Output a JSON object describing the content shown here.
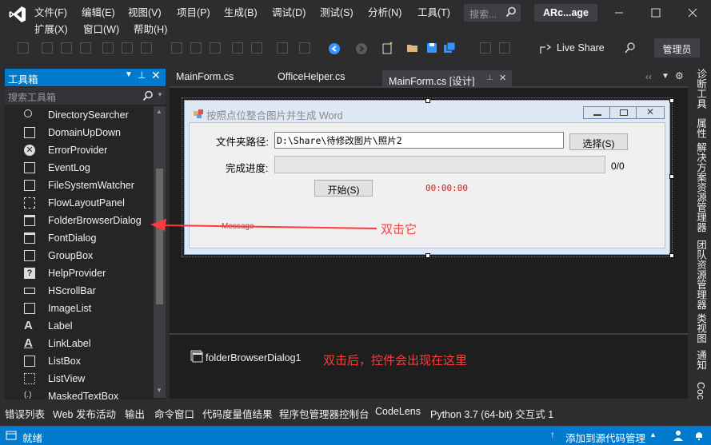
{
  "menu": {
    "row1": [
      "文件(F)",
      "编辑(E)",
      "视图(V)",
      "项目(P)",
      "生成(B)",
      "调试(D)",
      "测试(S)",
      "分析(N)",
      "工具(T)"
    ],
    "row2": [
      "扩展(X)",
      "窗口(W)",
      "帮助(H)"
    ]
  },
  "search": {
    "placeholder": "搜索..."
  },
  "app_name": "ARc...age",
  "toolbar": {
    "live_share": "Live Share",
    "admin": "管理员"
  },
  "toolbox": {
    "title": "工具箱",
    "search_placeholder": "搜索工具箱",
    "items": [
      "DirectorySearcher",
      "DomainUpDown",
      "ErrorProvider",
      "EventLog",
      "FileSystemWatcher",
      "FlowLayoutPanel",
      "FolderBrowserDialog",
      "FontDialog",
      "GroupBox",
      "HelpProvider",
      "HScrollBar",
      "ImageList",
      "Label",
      "LinkLabel",
      "ListBox",
      "ListView",
      "MaskedTextBox"
    ]
  },
  "tabs": [
    "MainForm.cs",
    "OfficeHelper.cs",
    "MainForm.cs [设计]"
  ],
  "form": {
    "title": "按照点位整合图片并生成 Word",
    "folder_label": "文件夹路径:",
    "folder_value": "D:\\Share\\待修改图片\\照片2",
    "choose_btn": "选择(S)",
    "progress_label": "完成进度:",
    "progress_value": "0/0",
    "progress_fraction": 0,
    "start_btn": "开始(S)",
    "timer": "00:00:00",
    "message": "Message"
  },
  "annotations": {
    "double_click": "双击它",
    "after": "双击后，控件会出现在这里"
  },
  "tray": {
    "component": "folderBrowserDialog1"
  },
  "right_tabs": [
    "诊断工具",
    "属性",
    "解决方案资源管理器",
    "团队资源管理器",
    "类视图",
    "通知",
    "Coc"
  ],
  "bottom_tabs": [
    "错误列表",
    "Web 发布活动",
    "输出",
    "命令窗口",
    "代码度量值结果",
    "程序包管理器控制台",
    "CodeLens",
    "Python 3.7 (64-bit) 交互式 1"
  ],
  "status": {
    "ready": "就绪",
    "source_control": "添加到源代码管理"
  },
  "colors": {
    "accent": "#007acc",
    "annotation": "#ff3b3b",
    "bg": "#2d2d30"
  }
}
